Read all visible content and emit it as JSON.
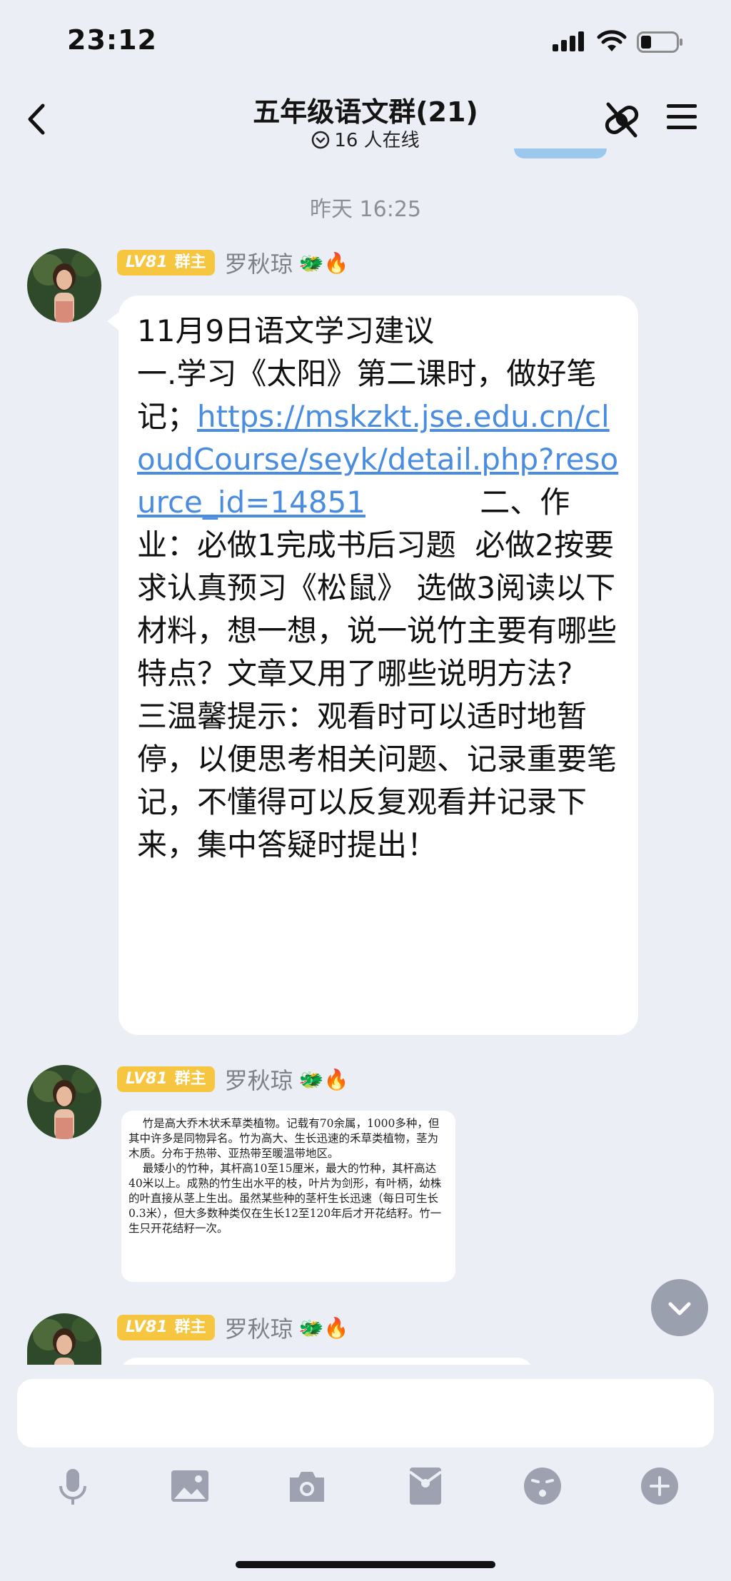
{
  "status_bar": {
    "time": "23:12"
  },
  "header": {
    "title": "五年级语文群(21)",
    "online": "16 人在线",
    "icons": [
      "back-arrow-icon",
      "unlink-icon",
      "menu-icon"
    ]
  },
  "timestamp": "昨天 16:25",
  "messages": [
    {
      "badge_level": "LV81",
      "badge_role": "群主",
      "sender": "罗秋琼",
      "emoji": "🐲🔥",
      "text_before_link": "11月9日语文学习建议\n一.学习《太阳》第二课时，做好笔记；",
      "link": "https://mskzkt.jse.edu.cn/cloudCourse/seyk/detail.php?resource_id=14851",
      "text_after_link": "            二、作业：必做1完成书后习题  必做2按要求认真预习《松鼠》 选做3阅读以下材料，想一想，说一说竹主要有哪些特点？文章又用了哪些说明方法?\n三温馨提示：观看时可以适时地暂停，以便思考相关问题、记录重要笔记，不懂得可以反复观看并记录下来，集中答疑时提出！"
    },
    {
      "badge_level": "LV81",
      "badge_role": "群主",
      "sender": "罗秋琼",
      "emoji": "🐲🔥",
      "image_text": "    竹是高大乔木状禾草类植物。记载有70余属，1000多种，但其中许多是同物异名。竹为高大、生长迅速的禾草类植物，茎为木质。分布于热带、亚热带至暖温带地区。\n    最矮小的竹种，其杆高10至15厘米，最大的竹种，其杆高达40米以上。成熟的竹生出水平的枝，叶片为剑形，有叶柄，幼株的叶直接从茎上生出。虽然某些种的茎杆生长迅速（每日可生长0.3米），但大多数种类仅在生长12至120年后才开花结籽。竹一生只开花结籽一次。"
    },
    {
      "badge_level": "LV81",
      "badge_role": "群主",
      "sender": "罗秋琼",
      "emoji": "🐲🔥"
    }
  ],
  "input": {
    "placeholder": "",
    "value": ""
  },
  "toolbar": [
    "microphone-icon",
    "image-icon",
    "camera-icon",
    "red-packet-icon",
    "emoji-icon",
    "plus-icon"
  ]
}
